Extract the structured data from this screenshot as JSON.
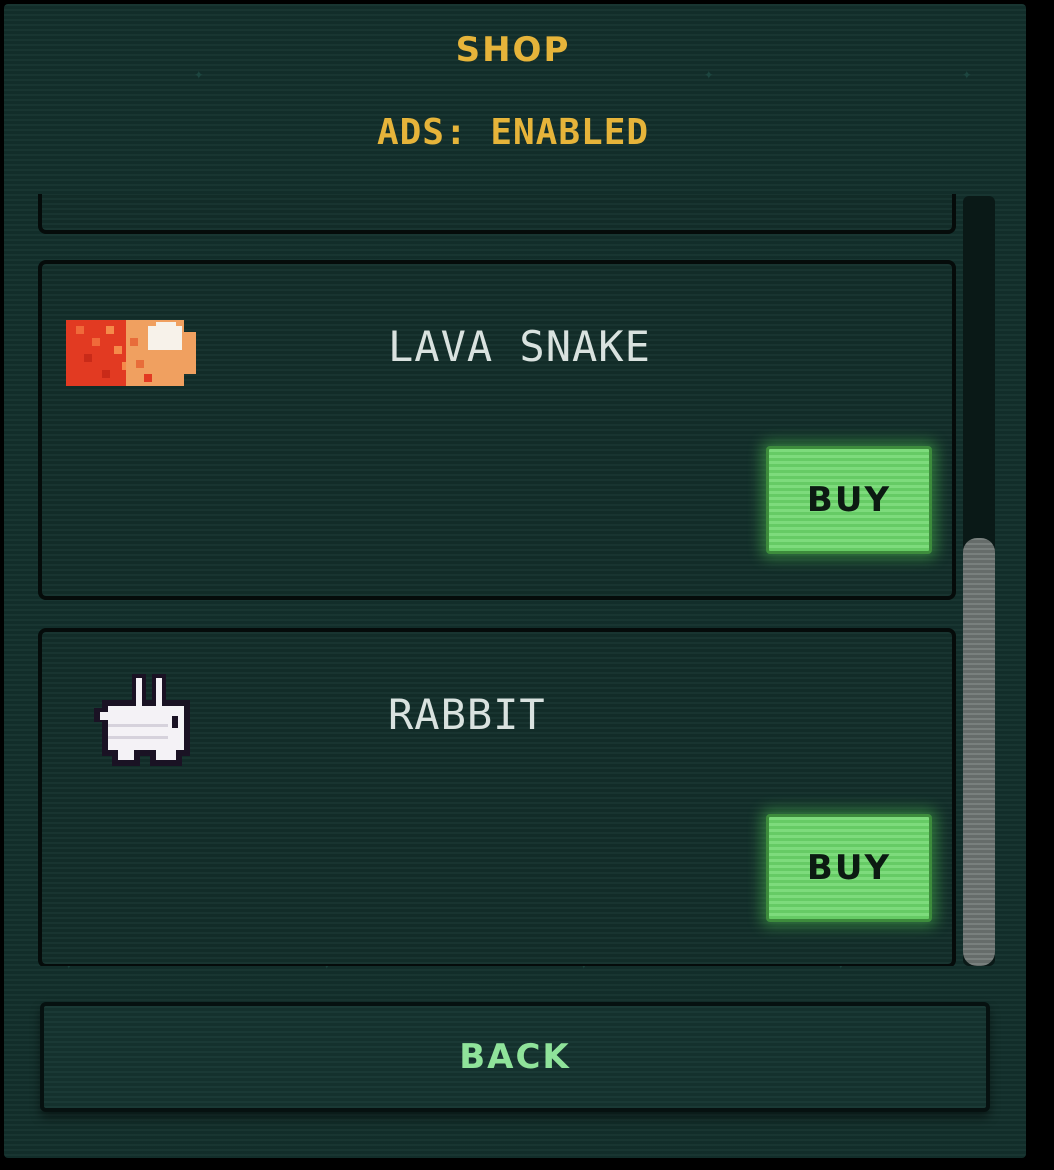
{
  "header": {
    "title": "SHOP",
    "ads_status": "ADS: ENABLED"
  },
  "items": [
    {
      "name": "LAVA SNAKE",
      "buy_label": "BUY",
      "icon": "lava-snake-icon"
    },
    {
      "name": "RABBIT",
      "buy_label": "BUY",
      "icon": "rabbit-icon"
    }
  ],
  "footer": {
    "back_label": "BACK"
  },
  "colors": {
    "accent_gold": "#e6b43a",
    "buy_green": "#6bd66a",
    "back_text": "#8fe39a",
    "panel_bg": "#13302c"
  }
}
